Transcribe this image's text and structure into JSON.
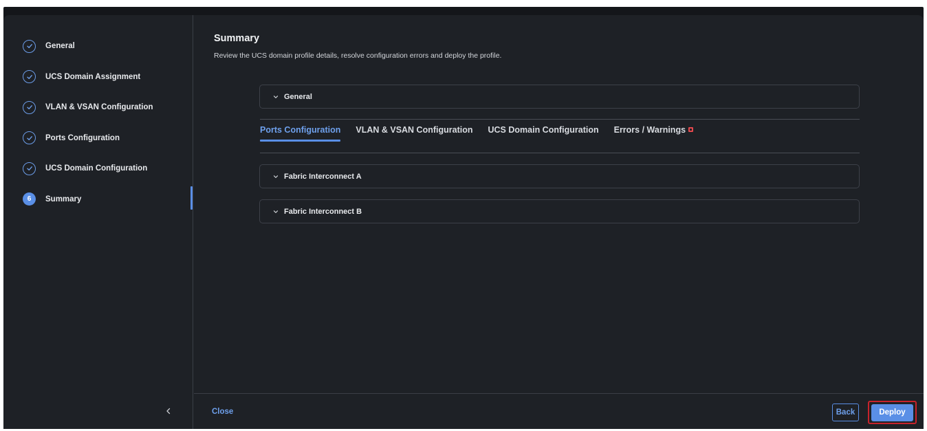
{
  "sidebar": {
    "steps": [
      {
        "label": "General",
        "state": "complete"
      },
      {
        "label": "UCS Domain Assignment",
        "state": "complete"
      },
      {
        "label": "VLAN & VSAN Configuration",
        "state": "complete"
      },
      {
        "label": "Ports Configuration",
        "state": "complete"
      },
      {
        "label": "UCS Domain Configuration",
        "state": "complete"
      },
      {
        "label": "Summary",
        "state": "current",
        "number": "6"
      }
    ],
    "collapse_icon": "chevron-left-icon"
  },
  "main": {
    "title": "Summary",
    "subtitle": "Review the UCS domain profile details, resolve configuration errors and deploy the profile.",
    "general_section": {
      "label": "General",
      "expanded": false
    },
    "tabs": [
      {
        "label": "Ports Configuration",
        "active": true
      },
      {
        "label": "VLAN & VSAN Configuration",
        "active": false
      },
      {
        "label": "UCS Domain Configuration",
        "active": false
      },
      {
        "label": "Errors / Warnings",
        "active": false,
        "has_error_badge": true
      }
    ],
    "sections": [
      {
        "label": "Fabric Interconnect A",
        "expanded": false
      },
      {
        "label": "Fabric Interconnect B",
        "expanded": false
      }
    ]
  },
  "footer": {
    "close_label": "Close",
    "back_label": "Back",
    "deploy_label": "Deploy"
  },
  "colors": {
    "accent": "#5a8fe6",
    "background": "#1e2126",
    "error": "#e5484d",
    "highlight_border": "#c8232c"
  }
}
